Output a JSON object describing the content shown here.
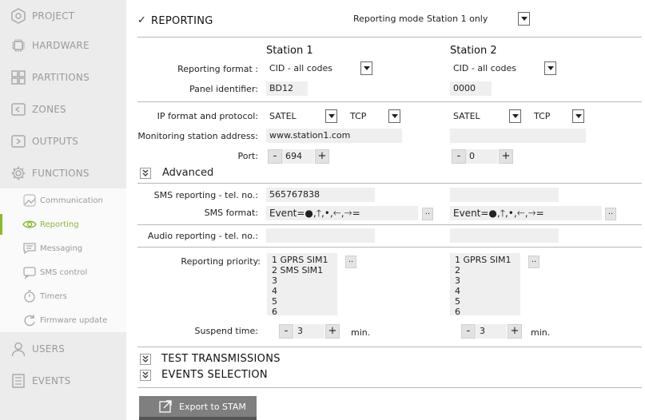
{
  "sidebar": {
    "items": [
      {
        "label": "PROJECT",
        "icon": "project-icon"
      },
      {
        "label": "HARDWARE",
        "icon": "chip-icon"
      },
      {
        "label": "PARTITIONS",
        "icon": "partitions-icon"
      },
      {
        "label": "ZONES",
        "icon": "zones-icon"
      },
      {
        "label": "OUTPUTS",
        "icon": "outputs-icon"
      },
      {
        "label": "FUNCTIONS",
        "icon": "gear-icon"
      },
      {
        "label": "USERS",
        "icon": "user-icon"
      },
      {
        "label": "EVENTS",
        "icon": "list-icon"
      }
    ],
    "subitems": [
      {
        "label": "Communication",
        "icon": "communication-icon"
      },
      {
        "label": "Reporting",
        "icon": "eye-icon"
      },
      {
        "label": "Messaging",
        "icon": "message-icon"
      },
      {
        "label": "SMS control",
        "icon": "sms-icon"
      },
      {
        "label": "Timers",
        "icon": "timer-icon"
      },
      {
        "label": "Firmware update",
        "icon": "refresh-icon"
      }
    ],
    "active_subitem": "Reporting",
    "accent_color": "#8bb92d"
  },
  "reporting": {
    "title": "REPORTING",
    "checkmark": "✓",
    "mode_label": "Reporting mode:",
    "mode_value": "Station 1 only"
  },
  "labels": {
    "reporting_format": "Reporting format :",
    "panel_identifier": "Panel identifier:",
    "ip_format": "IP format and protocol:",
    "monitoring_address": "Monitoring station address:",
    "port": "Port:",
    "advanced": "Advanced",
    "sms_tel": "SMS reporting - tel. no.:",
    "sms_format": "SMS format:",
    "audio_tel": "Audio reporting - tel. no.:",
    "priority": "Reporting priority:",
    "suspend": "Suspend time:",
    "min": "min.",
    "minus": "-",
    "plus": "+",
    "dots": ".."
  },
  "station1": {
    "header": "Station 1",
    "format": "CID - all codes",
    "panel_id": "BD12",
    "ip_format": "SATEL",
    "protocol": "TCP",
    "address": "www.station1.com",
    "port": "694",
    "sms_tel": "565767838",
    "sms_format": "Event=●,🡑,•,🡐,🡒=",
    "audio_tel": "",
    "priority": [
      "1 GPRS SIM1",
      "2 SMS SIM1",
      "3",
      "4",
      "5",
      "6"
    ],
    "suspend": "3"
  },
  "station2": {
    "header": "Station 2",
    "format": "CID - all codes",
    "panel_id": "0000",
    "ip_format": "SATEL",
    "protocol": "TCP",
    "address": "",
    "port": "0",
    "sms_tel": "",
    "sms_format": "Event=●,🡑,•,🡐,🡒=",
    "audio_tel": "",
    "priority": [
      "1 GPRS SIM1",
      "2",
      "3",
      "4",
      "5",
      "6"
    ],
    "suspend": "3"
  },
  "sections": {
    "test_transmissions": "TEST TRANSMISSIONS",
    "events_selection": "EVENTS SELECTION"
  },
  "export": {
    "label": "Export to STAM",
    "icon": "export-icon"
  }
}
